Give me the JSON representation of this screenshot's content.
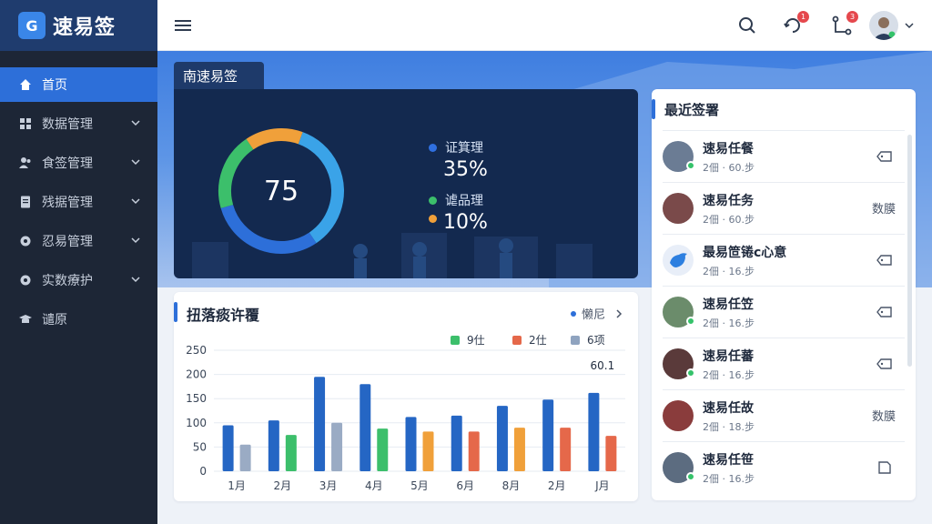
{
  "brand": {
    "name": "速易签",
    "logo_letter": "G"
  },
  "sidebar": {
    "items": [
      {
        "label": "首页",
        "icon": "home-icon",
        "active": true
      },
      {
        "label": "数据管理",
        "icon": "grid-icon"
      },
      {
        "label": "食签管理",
        "icon": "users-icon"
      },
      {
        "label": "残据管理",
        "icon": "document-icon"
      },
      {
        "label": "忍易管理",
        "icon": "gear-icon"
      },
      {
        "label": "实数療护",
        "icon": "gear-icon"
      },
      {
        "label": "谴原",
        "icon": "graduation-icon"
      }
    ]
  },
  "topbar": {
    "notification_badge": "1",
    "task_badge": "3"
  },
  "hero": {
    "tab_label": "南速易签"
  },
  "donut": {
    "center_value": "75",
    "legend": [
      {
        "label": "证箕理",
        "pct": "35%",
        "color": "#2f6fe0"
      },
      {
        "label": "谑品理",
        "pct": "10%",
        "color": "#3cbf6b"
      }
    ],
    "third_dot_color": "#f0a03a",
    "segments": [
      {
        "fraction": 0.35,
        "color": "#3aa3e8"
      },
      {
        "fraction": 0.3,
        "color": "#2d6fd9"
      },
      {
        "fraction": 0.2,
        "color": "#3cbf6b"
      },
      {
        "fraction": 0.15,
        "color": "#f0a03a"
      }
    ]
  },
  "bar_card": {
    "title": "扭落痰许覆",
    "more_label": "懒尼",
    "annotation": "60.1"
  },
  "chart_data": {
    "type": "bar",
    "categories": [
      "1月",
      "2月",
      "3月",
      "4月",
      "5月",
      "6月",
      "8月",
      "2月",
      "J月"
    ],
    "ylim": [
      0,
      250
    ],
    "yticks": [
      0,
      50,
      100,
      150,
      200,
      250
    ],
    "yticks_labels": [
      "0",
      "50",
      "100",
      "150",
      "200",
      "250"
    ],
    "series": [
      {
        "name": "9仕",
        "color": "#2566c4",
        "values": [
          95,
          105,
          195,
          180,
          112,
          115,
          135,
          148,
          162
        ]
      },
      {
        "name": "2仕",
        "color": "#3cbf6b",
        "values": [
          55,
          75,
          100,
          88,
          82,
          82,
          90,
          90,
          73
        ]
      },
      {
        "name": "6项",
        "color": "#8fa3bf",
        "values": [
          null,
          null,
          null,
          null,
          null,
          null,
          null,
          null,
          null
        ]
      }
    ],
    "series_colors_by_category": [
      [
        "#2566c4",
        "#9aabc4"
      ],
      [
        "#2566c4",
        "#3cbf6b"
      ],
      [
        "#2566c4",
        "#9aabc4"
      ],
      [
        "#2566c4",
        "#3cbf6b"
      ],
      [
        "#2566c4",
        "#f0a03a"
      ],
      [
        "#2566c4",
        "#e5684a"
      ],
      [
        "#2566c4",
        "#f0a03a"
      ],
      [
        "#2566c4",
        "#e5684a"
      ],
      [
        "#2566c4",
        "#e5684a"
      ]
    ],
    "legend": [
      {
        "label": "9仕",
        "color": "#3cbf6b"
      },
      {
        "label": "2仕",
        "color": "#e5684a"
      },
      {
        "label": "6项",
        "color": "#8fa3bf"
      }
    ]
  },
  "recent": {
    "title": "最近签署",
    "items": [
      {
        "title": "速易任餐",
        "sub": "2佃 · 60.步",
        "action_icon": "tag-icon",
        "online": true,
        "avatar_color": "#6b7c94"
      },
      {
        "title": "速易任务",
        "sub": "2佃 · 60.步",
        "action_text": "数膜",
        "online": false,
        "avatar_color": "#7a4a4a"
      },
      {
        "title": "最易笸锩c心意",
        "sub": "2佃 · 16.步",
        "action_icon": "tag-icon",
        "online": false,
        "avatar_color": "#2d7fe0"
      },
      {
        "title": "速易任笠",
        "sub": "2佃 · 16.步",
        "action_icon": "tag-icon",
        "online": true,
        "avatar_color": "#6b8c6b"
      },
      {
        "title": "速易任蕃",
        "sub": "2佃 · 16.步",
        "action_icon": "tag-icon",
        "online": true,
        "avatar_color": "#5a3a3a"
      },
      {
        "title": "速易任故",
        "sub": "2佃 · 18.步",
        "action_text": "数膜",
        "online": false,
        "avatar_color": "#8a3c3c"
      },
      {
        "title": "速易任笹",
        "sub": "2佃 · 16.步",
        "action_icon": "doc-icon",
        "online": true,
        "avatar_color": "#5c6c80"
      }
    ]
  }
}
